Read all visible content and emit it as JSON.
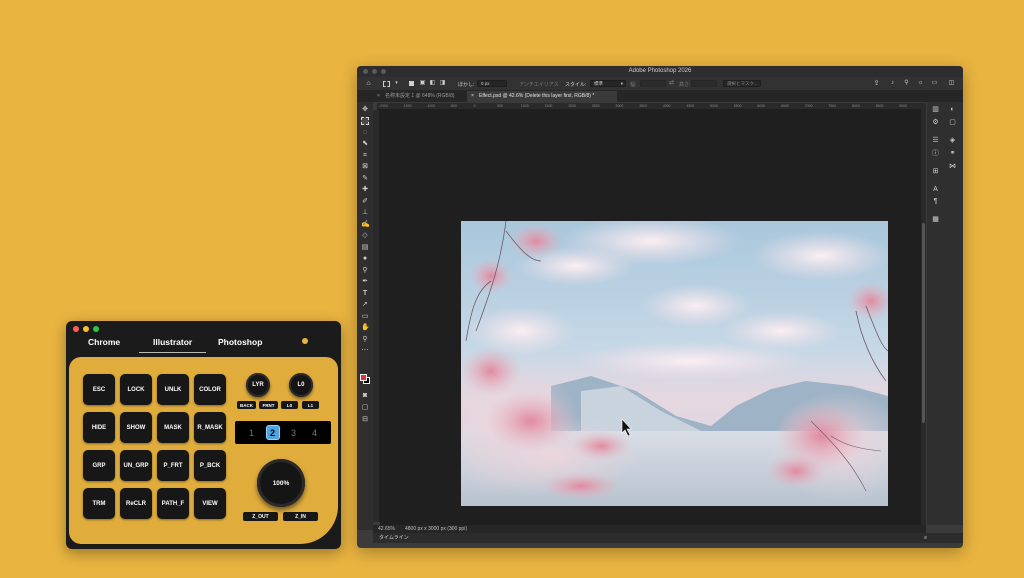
{
  "pad": {
    "tabs": [
      "Chrome",
      "Illustrator",
      "Photoshop"
    ],
    "active_tab": "Illustrator",
    "keys": [
      "ESC",
      "LOCK",
      "UNLK",
      "COLOR",
      "HIDE",
      "SHOW",
      "MASK",
      "R_MASK",
      "GRP",
      "UN_GRP",
      "P_FRT",
      "P_BCK",
      "TRM",
      "ReCLR",
      "PATH_F",
      "VIEW"
    ],
    "knob_lyr": "LYR",
    "knob_l0": "L0",
    "lyr_buttons": [
      "BACK",
      "FRNT"
    ],
    "l0_buttons": [
      "L0",
      "L1"
    ],
    "layer_slots": [
      "1",
      "2",
      "3",
      "4"
    ],
    "active_layer": "2",
    "zoom_knob": "100%",
    "zoom_buttons": [
      "Z_OUT",
      "Z_IN"
    ]
  },
  "photoshop": {
    "title": "Adobe Photoshop 2026",
    "options": {
      "feather_label": "ぼかし:",
      "feather_value": "0 px",
      "antialias": "アンチエイリアス",
      "style_label": "スタイル:",
      "style_value": "標準",
      "width_label": "幅:",
      "height_label": "高さ:",
      "select_mask": "選択とマスク..."
    },
    "doc_tabs": [
      {
        "label": "名称未設定 1 @ 648% (RGB/8)",
        "active": false
      },
      {
        "label": "Effect.psd @ 42.6% (Delete this layer first, RGB/8) *",
        "active": true
      }
    ],
    "ruler_marks": [
      "-2000",
      "-1500",
      "-1000",
      "-500",
      "0",
      "500",
      "1000",
      "1500",
      "2000",
      "2500",
      "3000",
      "3500",
      "4000",
      "4500",
      "5000",
      "5500",
      "6000",
      "6500",
      "7000",
      "7500",
      "8000",
      "8500",
      "9000"
    ],
    "status_zoom": "42.65%",
    "status_info": "4800 px x 3000 px (300 ppi)",
    "timeline_label": "タイムライン",
    "foreground_color": "#d8324a",
    "background_color": "#000000"
  }
}
